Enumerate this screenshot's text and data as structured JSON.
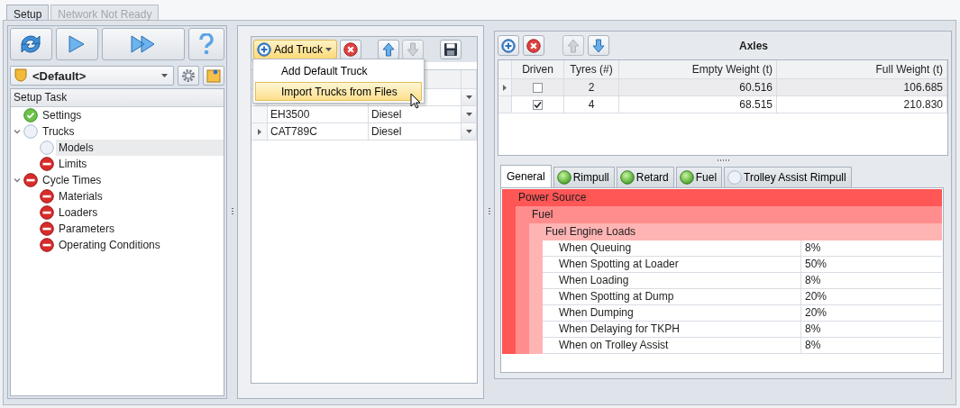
{
  "tabs": [
    {
      "label": "Setup",
      "selected": true,
      "disabled": false
    },
    {
      "label": "Network Not Ready",
      "selected": false,
      "disabled": true
    }
  ],
  "setup": {
    "profile": "<Default>",
    "task_header": "Setup Task",
    "tasks": [
      {
        "label": "Settings",
        "kind": "ok",
        "selected": false
      },
      {
        "label": "Trucks",
        "kind": "pending",
        "selected": false,
        "expanded": true,
        "children": [
          {
            "label": "Models",
            "kind": "pending",
            "selected": true
          },
          {
            "label": "Limits",
            "kind": "error",
            "selected": false
          }
        ]
      },
      {
        "label": "Cycle Times",
        "kind": "error",
        "selected": false,
        "expanded": true,
        "children": [
          {
            "label": "Materials",
            "kind": "error",
            "selected": false
          },
          {
            "label": "Loaders",
            "kind": "error",
            "selected": false
          },
          {
            "label": "Parameters",
            "kind": "error",
            "selected": false
          },
          {
            "label": "Operating Conditions",
            "kind": "error",
            "selected": false
          }
        ]
      }
    ]
  },
  "trucks": {
    "add_button": {
      "label": "Add Truck",
      "expanded": true
    },
    "menu": [
      {
        "label": "Add Default Truck",
        "selected": false
      },
      {
        "label": "Import Trucks from Files",
        "selected": true
      }
    ],
    "rows": [
      {
        "model": "EH3500",
        "fuel": "Diesel",
        "current": false
      },
      {
        "model": "CAT789C",
        "fuel": "Diesel",
        "current": true
      }
    ]
  },
  "axles": {
    "title": "Axles",
    "columns": [
      "Driven",
      "Tyres (#)",
      "Empty Weight (t)",
      "Full Weight (t)"
    ],
    "rows": [
      {
        "driven": false,
        "tyres": "2",
        "empty_weight": "60.516",
        "full_weight": "106.685",
        "current": true
      },
      {
        "driven": true,
        "tyres": "4",
        "empty_weight": "68.515",
        "full_weight": "210.830",
        "current": false
      }
    ]
  },
  "details": {
    "tabs": [
      {
        "label": "General",
        "kind": "plain",
        "selected": true
      },
      {
        "label": "Rimpull",
        "kind": "ok",
        "selected": false
      },
      {
        "label": "Retard",
        "kind": "ok",
        "selected": false
      },
      {
        "label": "Fuel",
        "kind": "ok",
        "selected": false
      },
      {
        "label": "Trolley Assist Rimpull",
        "kind": "pending",
        "selected": false
      }
    ],
    "property_grid": {
      "label": "Power Source",
      "children": [
        {
          "label": "Fuel",
          "children": [
            {
              "label": "Fuel Engine Loads",
              "rows": [
                {
                  "label": "When Queuing",
                  "value": "8%"
                },
                {
                  "label": "When Spotting at Loader",
                  "value": "50%"
                },
                {
                  "label": "When Loading",
                  "value": "8%"
                },
                {
                  "label": "When Spotting at Dump",
                  "value": "20%"
                },
                {
                  "label": "When Dumping",
                  "value": "20%"
                },
                {
                  "label": "When Delaying for TKPH",
                  "value": "8%"
                },
                {
                  "label": "When on Trolley Assist",
                  "value": "8%"
                }
              ]
            }
          ]
        }
      ]
    }
  }
}
